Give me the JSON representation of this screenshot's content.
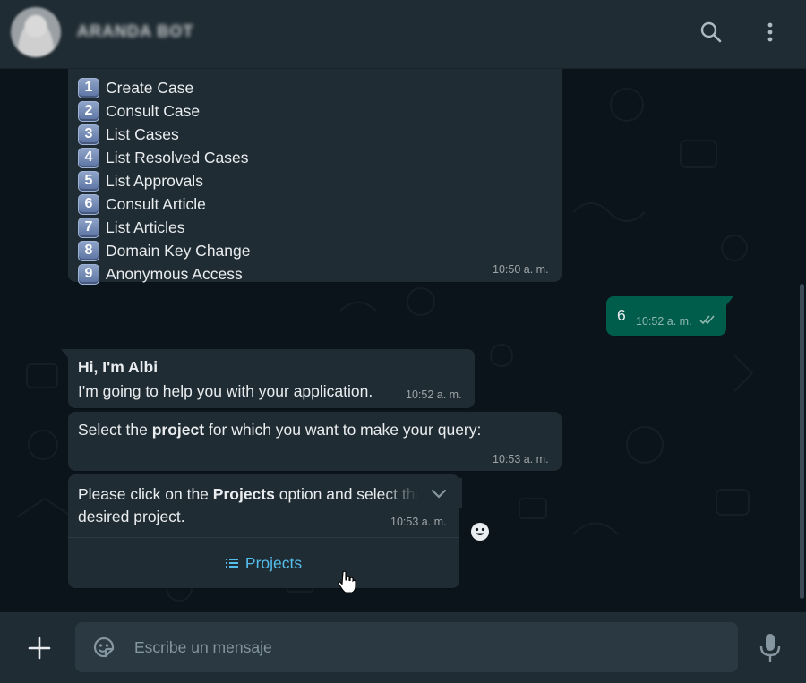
{
  "header": {
    "contact_name": "ARANDA BOT",
    "search_icon": "search-icon",
    "menu_icon": "kebab-menu-icon"
  },
  "menu_message": {
    "items": [
      {
        "number": "1",
        "label": "Create Case"
      },
      {
        "number": "2",
        "label": "Consult Case"
      },
      {
        "number": "3",
        "label": "List Cases"
      },
      {
        "number": "4",
        "label": "List Resolved Cases"
      },
      {
        "number": "5",
        "label": "List Approvals"
      },
      {
        "number": "6",
        "label": "Consult Article"
      },
      {
        "number": "7",
        "label": "List Articles"
      },
      {
        "number": "8",
        "label": "Domain Key Change"
      },
      {
        "number": "9",
        "label": "Anonymous Access"
      }
    ],
    "time": "10:50 a. m."
  },
  "outgoing_message": {
    "text": "6",
    "time": "10:52 a. m.",
    "status": "read"
  },
  "greeting_message": {
    "title": "Hi, I'm Albi",
    "body": "I'm going to help you with your application.",
    "time": "10:52 a. m."
  },
  "select_message": {
    "text_before": "Select the ",
    "text_bold": "project",
    "text_after": " for which you want to make your query:",
    "time": "10:53 a. m."
  },
  "projects_message": {
    "text_before": "Please click on the ",
    "text_bold": "Projects",
    "text_after": " option and select the desired project.",
    "time": "10:53 a. m.",
    "button_label": "Projects"
  },
  "composer": {
    "placeholder": "Escribe un mensaje"
  },
  "colors": {
    "header_bg": "#202c33",
    "chat_bg": "#0b141a",
    "incoming_bubble": "#202c33",
    "outgoing_bubble": "#005c4b",
    "link_blue": "#53bdeb",
    "read_ticks": "#53bdeb"
  }
}
